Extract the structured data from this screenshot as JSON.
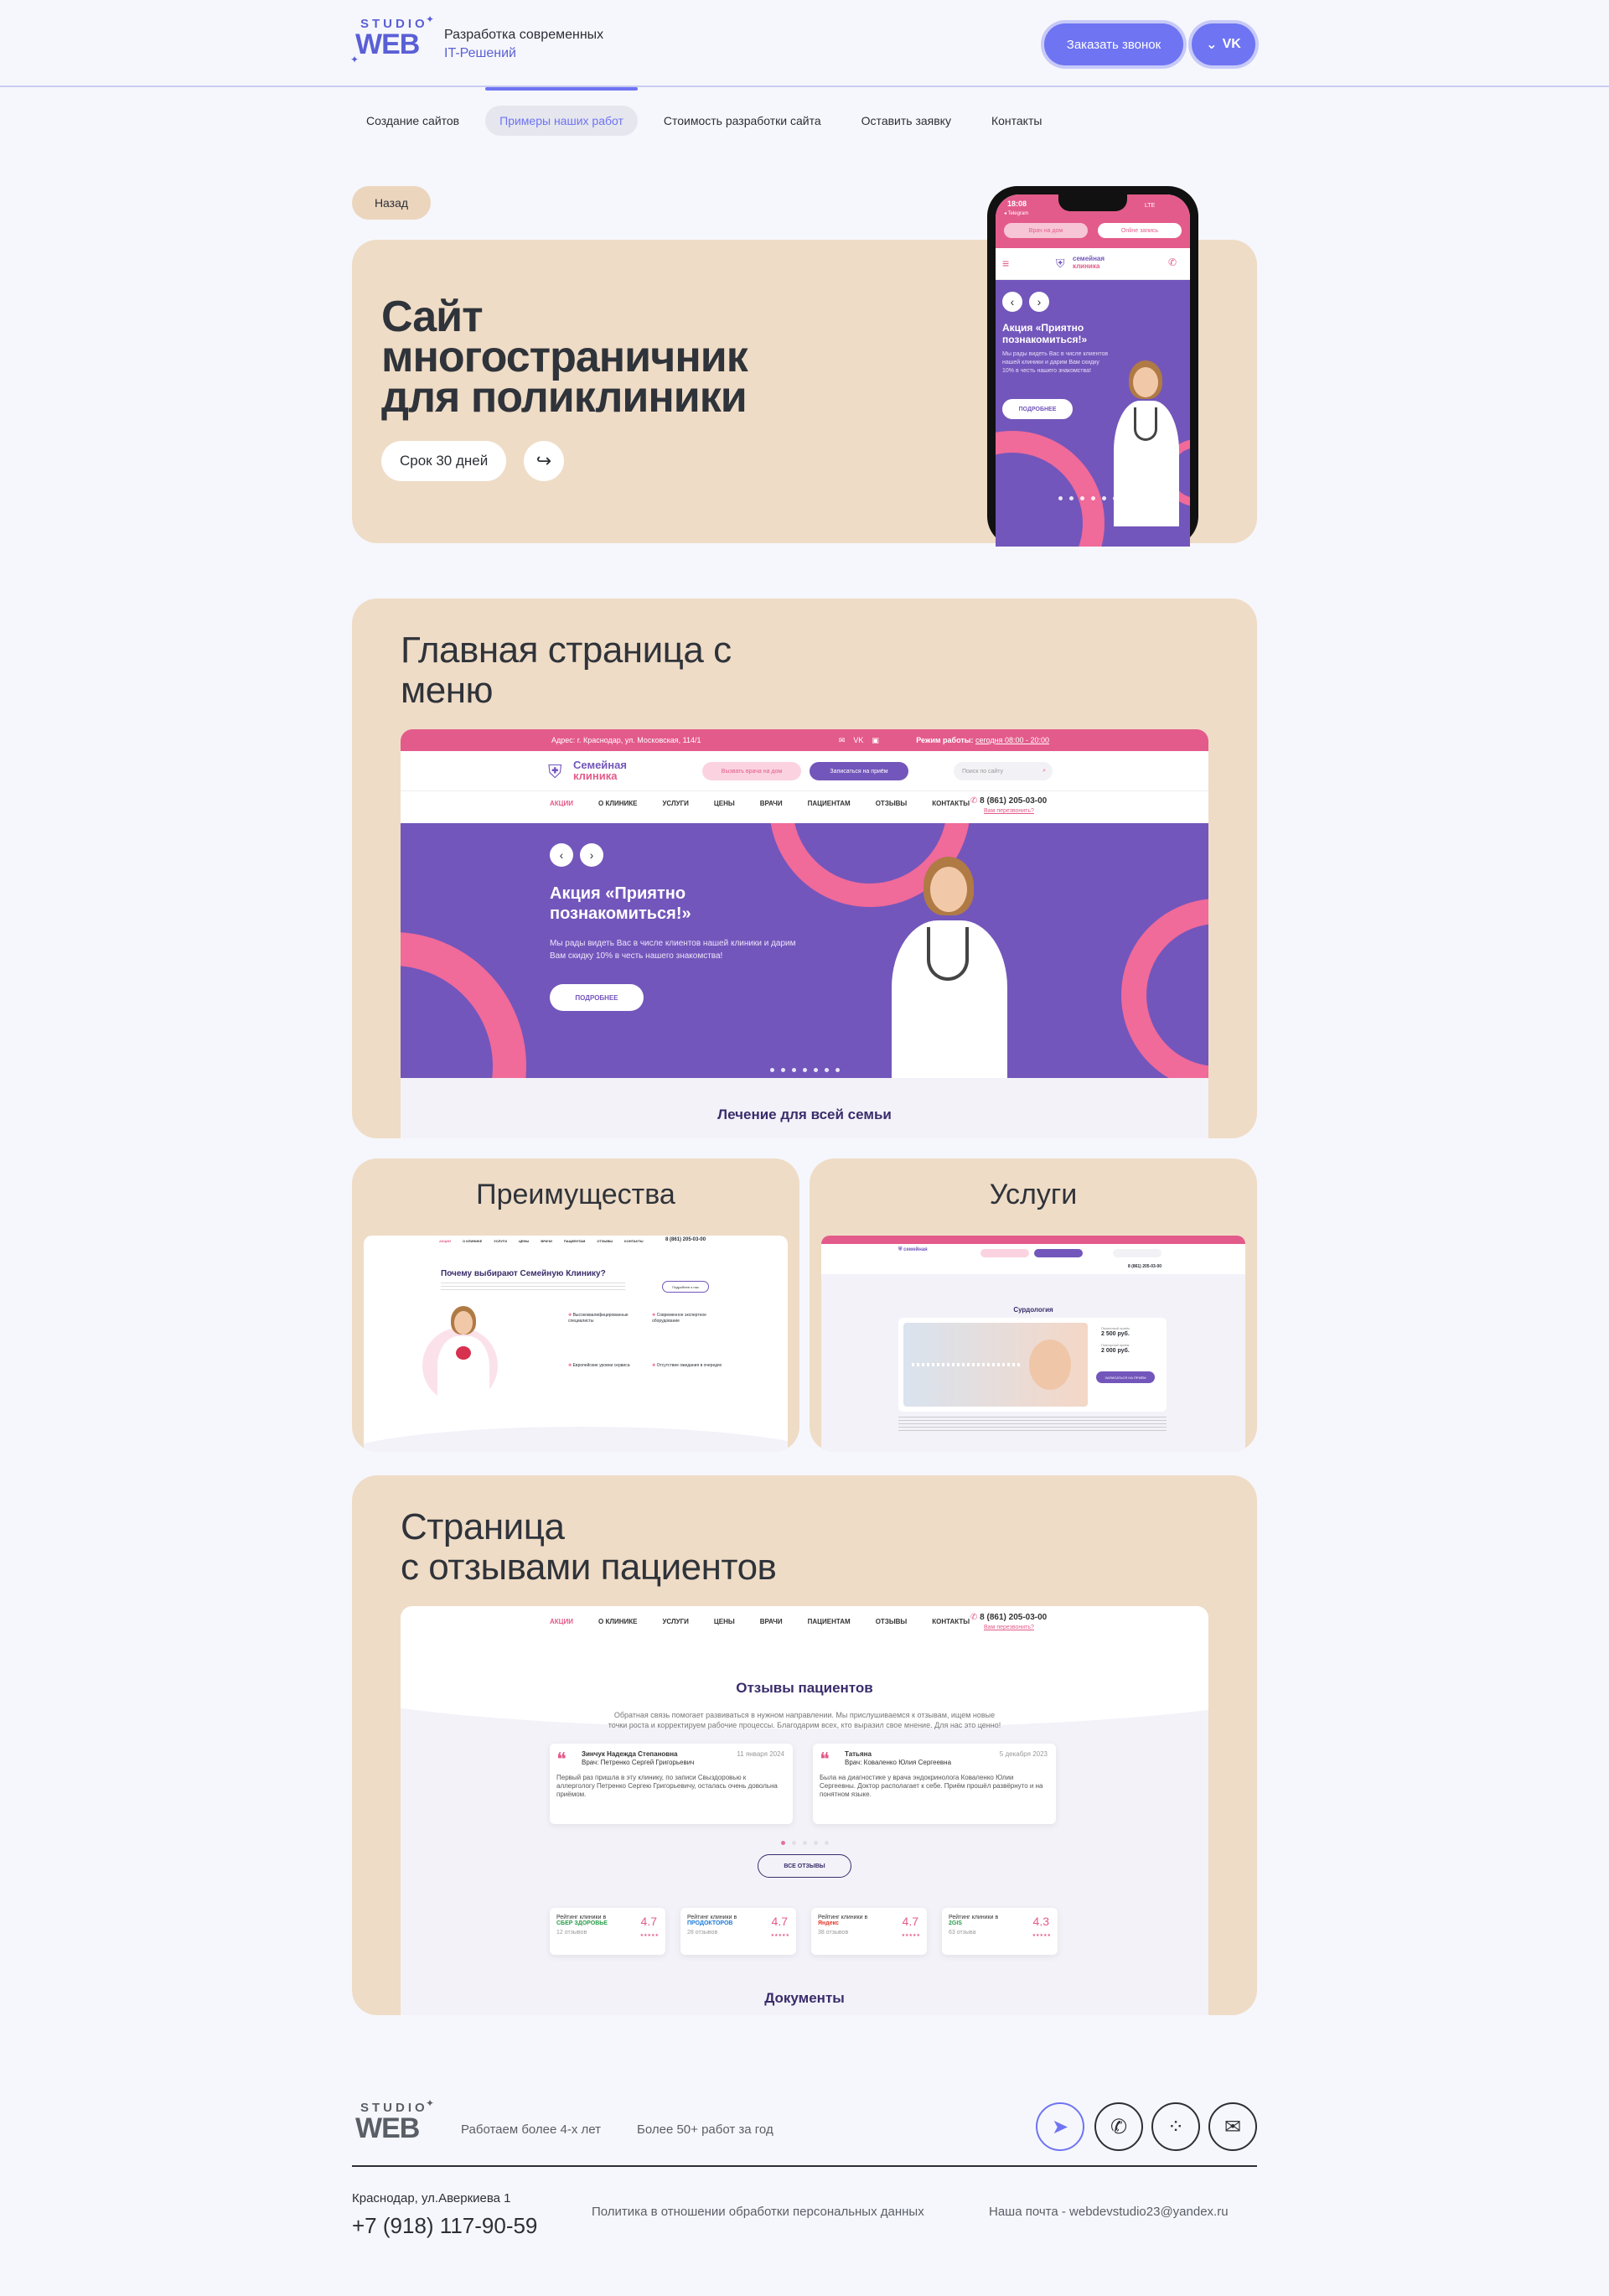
{
  "header": {
    "logo_top": "STUDIO",
    "logo_main": "WEB",
    "tagline_line1": "Разработка современных",
    "tagline_line2": "IT-Решений",
    "call_button": "Заказать звонок",
    "vk_button": "VK"
  },
  "nav": {
    "items": [
      "Создание сайтов",
      "Примеры наших работ",
      "Стоимость разработки сайта",
      "Оставить заявку",
      "Контакты"
    ],
    "active_index": 1
  },
  "hero": {
    "back_label": "Назад",
    "title_line1": "Сайт",
    "title_line2": "многостраничник",
    "title_line3": "для поликлиники",
    "term": "Срок 30 дней"
  },
  "phone_mock": {
    "time": "18:08",
    "carrier": "◂ Telegram",
    "network": "LTE",
    "btn1": "Врач на дом",
    "btn2": "Online запись",
    "logo_line1": "семейная",
    "logo_line2": "клиника",
    "promo_title": "Акция «Приятно познакомиться!»",
    "promo_text": "Мы рады видеть Вас в числе клиентов нашей клиники и дарим Вам скидку 10% в честь нашего знакомства!",
    "promo_button": "ПОДРОБНЕЕ"
  },
  "main_page": {
    "title_line1": "Главная страница с",
    "title_line2": "меню",
    "topbar_address": "Адрес: г. Краснодар, ул. Московская, 114/1",
    "topbar_hours": "Режим работы: ",
    "topbar_hours_link": "сегодня 08:00 - 20:00",
    "logo_line1": "Семейная",
    "logo_line2": "клиника",
    "btn_home": "Вызвать врача на дом",
    "btn_appoint": "Записаться на приём",
    "search_placeholder": "Поиск по сайту",
    "menu": [
      "АКЦИИ",
      "О КЛИНИКЕ",
      "УСЛУГИ",
      "ЦЕНЫ",
      "ВРАЧИ",
      "ПАЦИЕНТАМ",
      "ОТЗЫВЫ",
      "КОНТАКТЫ"
    ],
    "phone": "8 (861) 205-03-00",
    "callback": "Вам перезвонить?",
    "promo_title_line1": "Акция «Приятно",
    "promo_title_line2": "познакомиться!»",
    "promo_text_line1": "Мы рады видеть Вас в числе клиентов нашей клиники и дарим",
    "promo_text_line2": "Вам скидку 10% в честь нашего знакомства!",
    "promo_button": "ПОДРОБНЕЕ",
    "bottom_heading": "Лечение для всей семьи"
  },
  "advantages": {
    "title": "Преимущества",
    "heading": "Почему выбирают Семейную Клинику?",
    "phone": "8 (861) 205-03-00",
    "button": "Подробнее о нас",
    "items": [
      "Высококвалифицированные специалисты",
      "Современное экспертное оборудование",
      "Европейские уровни сервиса",
      "Отсутствие ожидания в очередях"
    ]
  },
  "services": {
    "title": "Услуги",
    "heading": "Сурдология",
    "phone": "8 (861) 205-03-00",
    "price1_label": "Первичный приём",
    "price1": "2 500 руб.",
    "price2_label": "Повторный приём",
    "price2": "2 000 руб.",
    "button": "ЗАПИСАТЬСЯ НА ПРИЁМ"
  },
  "reviews": {
    "title_line1": "Страница",
    "title_line2": "с отзывами пациентов",
    "menu": [
      "АКЦИИ",
      "О КЛИНИКЕ",
      "УСЛУГИ",
      "ЦЕНЫ",
      "ВРАЧИ",
      "ПАЦИЕНТАМ",
      "ОТЗЫВЫ",
      "КОНТАКТЫ"
    ],
    "phone": "8 (861) 205-03-00",
    "callback": "Вам перезвонить?",
    "heading": "Отзывы пациентов",
    "intro_line1": "Обратная связь помогает развиваться в нужном направлении. Мы прислушиваемся к отзывам, ищем новые",
    "intro_line2": "точки роста и корректируем рабочие процессы. Благодарим всех, кто выразил свое мнение. Для нас это ценно!",
    "cards": [
      {
        "name": "Зинчук Надежда Степановна",
        "doctor": "Врач: Петренко Сергей Григорьевич",
        "date": "11 января 2024",
        "text": "Первый раз пришла в эту клинику, по записи Свыздоровью к аллергологу Петренко Сергею Григорьевичу, осталась очень довольна приёмом."
      },
      {
        "name": "Татьяна",
        "doctor": "Врач: Коваленко Юлия Сергеевна",
        "date": "5 декабря 2023",
        "text": "Была на диагностике у врача эндокринолога Коваленко Юлии Сергеевны. Доктор располагает к себе. Приём прошёл развёрнуто и на понятном языке."
      }
    ],
    "all_button": "ВСЕ ОТЗЫВЫ",
    "ratings": [
      {
        "label": "Рейтинг клиники в",
        "source": "СБЕР ЗДОРОВЬЕ",
        "score": "4.7",
        "count": "12 отзывов"
      },
      {
        "label": "Рейтинг клиники в",
        "source": "ПРОДОКТОРОВ",
        "score": "4.7",
        "count": "28 отзывов"
      },
      {
        "label": "Рейтинг клиники в",
        "source": "Яндекс",
        "score": "4.7",
        "count": "38 отзывов"
      },
      {
        "label": "Рейтинг клиники в",
        "source": "2GIS",
        "score": "4.3",
        "count": "63 отзыва"
      }
    ],
    "documents_heading": "Документы"
  },
  "footer": {
    "experience": "Работаем более 4-х лет",
    "works": "Более 50+ работ за год",
    "address": "Краснодар, ул.Аверкиева 1",
    "phone": "+7 (918) 117-90-59",
    "policy": "Политика в отношении обработки персональных данных",
    "email": "Наша почта - webdevstudio23@yandex.ru"
  },
  "colors": {
    "accent": "#6e74f2",
    "card": "#efdcc6",
    "clinic_pink": "#e35b8a",
    "clinic_purple": "#7356bb",
    "background": "#f6f7fc"
  }
}
